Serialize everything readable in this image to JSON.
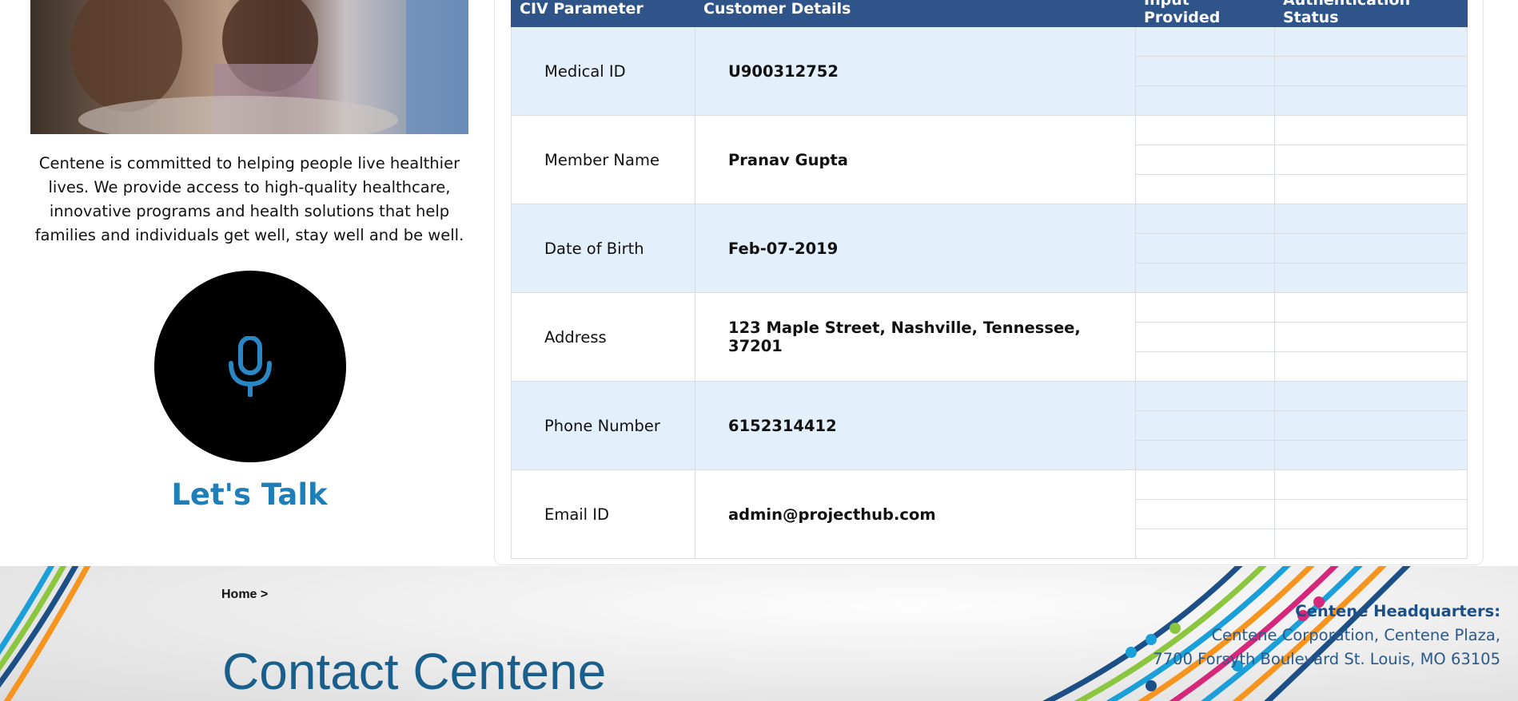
{
  "left": {
    "mission": "Centene is committed to helping people live healthier lives. We provide access to high-quality healthcare, innovative programs and health solutions that help families and individuals get well, stay well and be well.",
    "cta": "Let's Talk",
    "mic_icon": "microphone-icon"
  },
  "table": {
    "headers": [
      "CIV Parameter",
      "Customer Details",
      "Input Provided",
      "Authentication Status"
    ],
    "rows": [
      {
        "param": "Medical ID",
        "detail": "U900312752"
      },
      {
        "param": "Member Name",
        "detail": "Pranav Gupta"
      },
      {
        "param": "Date of Birth",
        "detail": "Feb-07-2019"
      },
      {
        "param": "Address",
        "detail": "123 Maple Street, Nashville, Tennessee, 37201"
      },
      {
        "param": "Phone Number",
        "detail": "6152314412"
      },
      {
        "param": "Email ID",
        "detail": "admin@projecthub.com"
      }
    ],
    "header_color": "#2e5489",
    "row_shade": "#e3f0fc"
  },
  "footer": {
    "breadcrumb": "Home >",
    "title": "Contact Centene",
    "hq_title": "Centene Headquarters:",
    "hq_line1": "Centene Corporation, Centene Plaza,",
    "hq_line2": "7700 Forsyth Boulevard St. Louis, MO 63105"
  }
}
